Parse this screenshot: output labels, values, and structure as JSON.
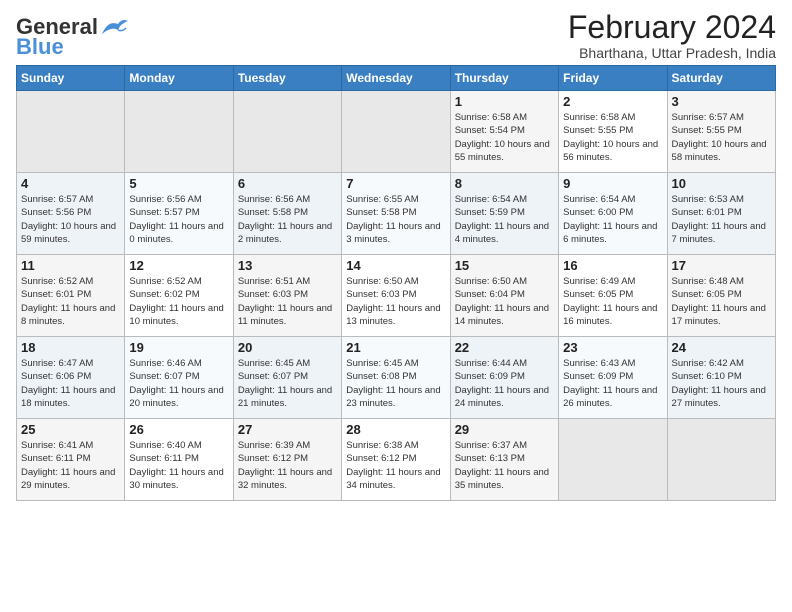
{
  "header": {
    "logo_general": "General",
    "logo_blue": "Blue",
    "month": "February 2024",
    "location": "Bharthana, Uttar Pradesh, India"
  },
  "days_of_week": [
    "Sunday",
    "Monday",
    "Tuesday",
    "Wednesday",
    "Thursday",
    "Friday",
    "Saturday"
  ],
  "weeks": [
    [
      {
        "day": "",
        "sunrise": "",
        "sunset": "",
        "daylight": "",
        "empty": true
      },
      {
        "day": "",
        "sunrise": "",
        "sunset": "",
        "daylight": "",
        "empty": true
      },
      {
        "day": "",
        "sunrise": "",
        "sunset": "",
        "daylight": "",
        "empty": true
      },
      {
        "day": "",
        "sunrise": "",
        "sunset": "",
        "daylight": "",
        "empty": true
      },
      {
        "day": "1",
        "sunrise": "Sunrise: 6:58 AM",
        "sunset": "Sunset: 5:54 PM",
        "daylight": "Daylight: 10 hours and 55 minutes."
      },
      {
        "day": "2",
        "sunrise": "Sunrise: 6:58 AM",
        "sunset": "Sunset: 5:55 PM",
        "daylight": "Daylight: 10 hours and 56 minutes."
      },
      {
        "day": "3",
        "sunrise": "Sunrise: 6:57 AM",
        "sunset": "Sunset: 5:55 PM",
        "daylight": "Daylight: 10 hours and 58 minutes."
      }
    ],
    [
      {
        "day": "4",
        "sunrise": "Sunrise: 6:57 AM",
        "sunset": "Sunset: 5:56 PM",
        "daylight": "Daylight: 10 hours and 59 minutes."
      },
      {
        "day": "5",
        "sunrise": "Sunrise: 6:56 AM",
        "sunset": "Sunset: 5:57 PM",
        "daylight": "Daylight: 11 hours and 0 minutes."
      },
      {
        "day": "6",
        "sunrise": "Sunrise: 6:56 AM",
        "sunset": "Sunset: 5:58 PM",
        "daylight": "Daylight: 11 hours and 2 minutes."
      },
      {
        "day": "7",
        "sunrise": "Sunrise: 6:55 AM",
        "sunset": "Sunset: 5:58 PM",
        "daylight": "Daylight: 11 hours and 3 minutes."
      },
      {
        "day": "8",
        "sunrise": "Sunrise: 6:54 AM",
        "sunset": "Sunset: 5:59 PM",
        "daylight": "Daylight: 11 hours and 4 minutes."
      },
      {
        "day": "9",
        "sunrise": "Sunrise: 6:54 AM",
        "sunset": "Sunset: 6:00 PM",
        "daylight": "Daylight: 11 hours and 6 minutes."
      },
      {
        "day": "10",
        "sunrise": "Sunrise: 6:53 AM",
        "sunset": "Sunset: 6:01 PM",
        "daylight": "Daylight: 11 hours and 7 minutes."
      }
    ],
    [
      {
        "day": "11",
        "sunrise": "Sunrise: 6:52 AM",
        "sunset": "Sunset: 6:01 PM",
        "daylight": "Daylight: 11 hours and 8 minutes."
      },
      {
        "day": "12",
        "sunrise": "Sunrise: 6:52 AM",
        "sunset": "Sunset: 6:02 PM",
        "daylight": "Daylight: 11 hours and 10 minutes."
      },
      {
        "day": "13",
        "sunrise": "Sunrise: 6:51 AM",
        "sunset": "Sunset: 6:03 PM",
        "daylight": "Daylight: 11 hours and 11 minutes."
      },
      {
        "day": "14",
        "sunrise": "Sunrise: 6:50 AM",
        "sunset": "Sunset: 6:03 PM",
        "daylight": "Daylight: 11 hours and 13 minutes."
      },
      {
        "day": "15",
        "sunrise": "Sunrise: 6:50 AM",
        "sunset": "Sunset: 6:04 PM",
        "daylight": "Daylight: 11 hours and 14 minutes."
      },
      {
        "day": "16",
        "sunrise": "Sunrise: 6:49 AM",
        "sunset": "Sunset: 6:05 PM",
        "daylight": "Daylight: 11 hours and 16 minutes."
      },
      {
        "day": "17",
        "sunrise": "Sunrise: 6:48 AM",
        "sunset": "Sunset: 6:05 PM",
        "daylight": "Daylight: 11 hours and 17 minutes."
      }
    ],
    [
      {
        "day": "18",
        "sunrise": "Sunrise: 6:47 AM",
        "sunset": "Sunset: 6:06 PM",
        "daylight": "Daylight: 11 hours and 18 minutes."
      },
      {
        "day": "19",
        "sunrise": "Sunrise: 6:46 AM",
        "sunset": "Sunset: 6:07 PM",
        "daylight": "Daylight: 11 hours and 20 minutes."
      },
      {
        "day": "20",
        "sunrise": "Sunrise: 6:45 AM",
        "sunset": "Sunset: 6:07 PM",
        "daylight": "Daylight: 11 hours and 21 minutes."
      },
      {
        "day": "21",
        "sunrise": "Sunrise: 6:45 AM",
        "sunset": "Sunset: 6:08 PM",
        "daylight": "Daylight: 11 hours and 23 minutes."
      },
      {
        "day": "22",
        "sunrise": "Sunrise: 6:44 AM",
        "sunset": "Sunset: 6:09 PM",
        "daylight": "Daylight: 11 hours and 24 minutes."
      },
      {
        "day": "23",
        "sunrise": "Sunrise: 6:43 AM",
        "sunset": "Sunset: 6:09 PM",
        "daylight": "Daylight: 11 hours and 26 minutes."
      },
      {
        "day": "24",
        "sunrise": "Sunrise: 6:42 AM",
        "sunset": "Sunset: 6:10 PM",
        "daylight": "Daylight: 11 hours and 27 minutes."
      }
    ],
    [
      {
        "day": "25",
        "sunrise": "Sunrise: 6:41 AM",
        "sunset": "Sunset: 6:11 PM",
        "daylight": "Daylight: 11 hours and 29 minutes."
      },
      {
        "day": "26",
        "sunrise": "Sunrise: 6:40 AM",
        "sunset": "Sunset: 6:11 PM",
        "daylight": "Daylight: 11 hours and 30 minutes."
      },
      {
        "day": "27",
        "sunrise": "Sunrise: 6:39 AM",
        "sunset": "Sunset: 6:12 PM",
        "daylight": "Daylight: 11 hours and 32 minutes."
      },
      {
        "day": "28",
        "sunrise": "Sunrise: 6:38 AM",
        "sunset": "Sunset: 6:12 PM",
        "daylight": "Daylight: 11 hours and 34 minutes."
      },
      {
        "day": "29",
        "sunrise": "Sunrise: 6:37 AM",
        "sunset": "Sunset: 6:13 PM",
        "daylight": "Daylight: 11 hours and 35 minutes."
      },
      {
        "day": "",
        "sunrise": "",
        "sunset": "",
        "daylight": "",
        "empty": true
      },
      {
        "day": "",
        "sunrise": "",
        "sunset": "",
        "daylight": "",
        "empty": true
      }
    ]
  ]
}
